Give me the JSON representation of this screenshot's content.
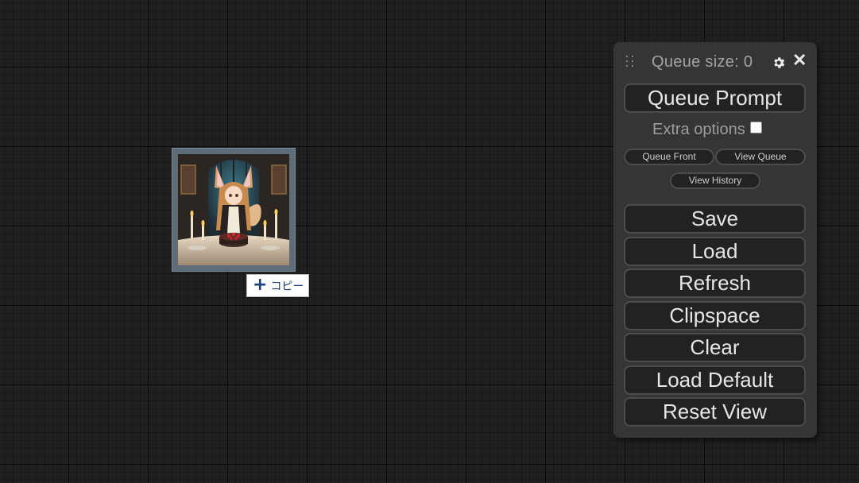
{
  "menu": {
    "queue_size_label": "Queue size:",
    "queue_size_value": "0",
    "queue_prompt": "Queue Prompt",
    "extra_options": "Extra options",
    "extra_options_checked": false,
    "queue_front": "Queue Front",
    "view_queue": "View Queue",
    "view_history": "View History",
    "buttons": [
      "Save",
      "Load",
      "Refresh",
      "Clipspace",
      "Clear",
      "Load Default",
      "Reset View"
    ]
  },
  "drag": {
    "copy_tip": "コピー"
  },
  "colors": {
    "canvas": "#202020",
    "panel": "#353535",
    "button": "#222222",
    "button_border": "#4c4c4c"
  }
}
